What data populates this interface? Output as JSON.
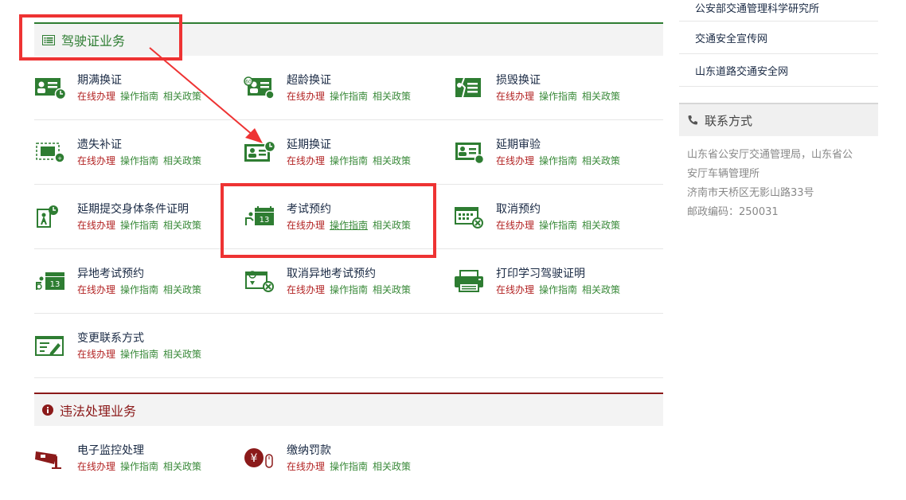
{
  "driver_section": {
    "title": "驾驶证业务",
    "services": [
      {
        "name": "期满换证",
        "icon": "id-card-clock-icon"
      },
      {
        "name": "超龄换证",
        "icon": "id-card-age-icon"
      },
      {
        "name": "损毁换证",
        "icon": "damaged-card-icon"
      },
      {
        "name": "遗失补证",
        "icon": "lost-card-icon"
      },
      {
        "name": "延期换证",
        "icon": "id-card-delay-icon"
      },
      {
        "name": "延期审验",
        "icon": "id-card-review-icon"
      },
      {
        "name": "延期提交身体条件证明",
        "icon": "health-certificate-icon"
      },
      {
        "name": "考试预约",
        "icon": "exam-calendar-icon"
      },
      {
        "name": "取消预约",
        "icon": "cancel-calendar-icon"
      },
      {
        "name": "异地考试预约",
        "icon": "remote-exam-calendar-icon"
      },
      {
        "name": "取消异地考试预约",
        "icon": "cancel-remote-calendar-icon"
      },
      {
        "name": "打印学习驾驶证明",
        "icon": "printer-icon"
      },
      {
        "name": "变更联系方式",
        "icon": "contact-edit-icon"
      }
    ]
  },
  "violation_section": {
    "title": "违法处理业务",
    "services": [
      {
        "name": "电子监控处理",
        "icon": "surveillance-camera-icon"
      },
      {
        "name": "缴纳罚款",
        "icon": "yuan-payment-icon"
      }
    ]
  },
  "link_labels": {
    "online": "在线办理",
    "guide": "操作指南",
    "policy": "相关政策"
  },
  "sidebar": {
    "links": [
      "公安部交通管理科学研究所",
      "交通安全宣传网",
      "山东道路交通安全网"
    ],
    "contact": {
      "title": "联系方式",
      "lines": [
        "山东省公安厅交通管理局，山东省公",
        "安厅车辆管理所",
        "济南市天桥区无影山路33号",
        "邮政编码：250031"
      ]
    }
  },
  "colors": {
    "green": "#2e7d32",
    "red_link": "#b22222",
    "green_link": "#3a8a3a",
    "annotation": "#ee3333",
    "violation_red": "#8b1a1a"
  }
}
